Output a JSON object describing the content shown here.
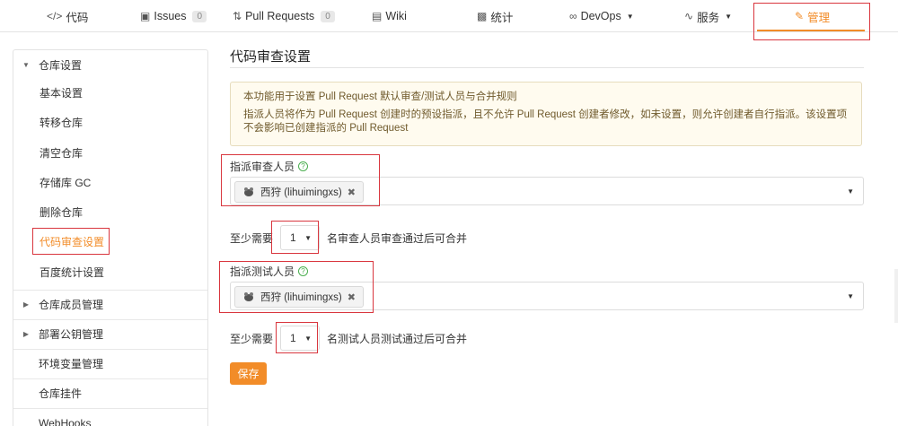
{
  "nav": {
    "code": "代码",
    "issues": "Issues",
    "issues_count": "0",
    "pull_requests": "Pull Requests",
    "pr_count": "0",
    "wiki": "Wiki",
    "stats": "统计",
    "devops": "DevOps",
    "services": "服务",
    "manage": "管理"
  },
  "sidebar": {
    "repo_settings": "仓库设置",
    "items": [
      "基本设置",
      "转移仓库",
      "清空仓库",
      "存储库 GC",
      "删除仓库",
      "代码审查设置",
      "百度统计设置"
    ],
    "active_item": "代码审查设置",
    "members": "仓库成员管理",
    "deploy_keys": "部署公钥管理",
    "env_vars": "环境变量管理",
    "plugins": "仓库挂件",
    "webhooks": "WebHooks"
  },
  "main": {
    "title": "代码审查设置",
    "notice_line1": "本功能用于设置 Pull Request 默认审查/测试人员与合并规则",
    "notice_line2": "指派人员将作为 Pull Request 创建时的预设指派，且不允许 Pull Request 创建者修改，如未设置，则允许创建者自行指派。该设置项不会影响已创建指派的 Pull Request",
    "reviewer_label": "指派审查人员",
    "reviewer_tag": "西狩 (lihuimingxs)",
    "review_prefix": "至少需要",
    "review_count": "1",
    "review_suffix": "名审查人员审查通过后可合并",
    "tester_label": "指派测试人员",
    "tester_tag": "西狩 (lihuimingxs)",
    "test_prefix": "至少需要",
    "test_count": "1",
    "test_suffix": "名测试人员测试通过后可合并",
    "save": "保存"
  },
  "colors": {
    "accent": "#f28c28",
    "highlight_box": "#d9363e",
    "notice_bg": "#fffbef"
  }
}
